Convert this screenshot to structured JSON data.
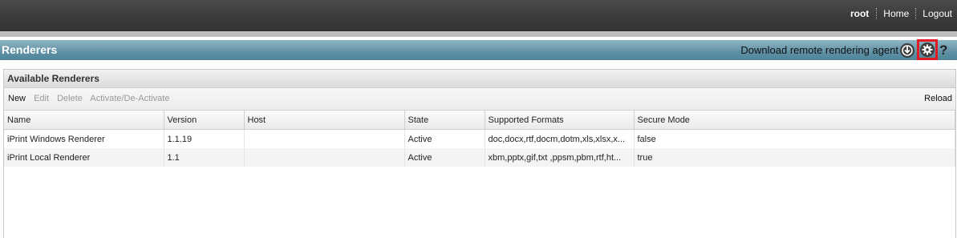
{
  "topnav": {
    "user": "root",
    "home": "Home",
    "logout": "Logout"
  },
  "header": {
    "title": "Renderers",
    "download_text": "Download remote rendering agent"
  },
  "panel": {
    "title": "Available Renderers",
    "toolbar": {
      "new": "New",
      "edit": "Edit",
      "delete": "Delete",
      "activate": "Activate/De-Activate",
      "reload": "Reload"
    },
    "columns": [
      "Name",
      "Version",
      "Host",
      "State",
      "Supported Formats",
      "Secure Mode"
    ],
    "rows": [
      {
        "name": "iPrint Windows Renderer",
        "version": "1.1.19",
        "host": "",
        "state": "Active",
        "formats": "doc,docx,rtf,docm,dotm,xls,xlsx,x...",
        "secure": "false"
      },
      {
        "name": "iPrint Local Renderer",
        "version": "1.1",
        "host": "",
        "state": "Active",
        "formats": "xbm,pptx,gif,txt ,ppsm,pbm,rtf,ht...",
        "secure": "true"
      }
    ]
  },
  "icons": {
    "download": "download-agent-icon",
    "settings": "gear-icon",
    "help": "help-icon"
  },
  "colors": {
    "topbar": "#3b3b3b",
    "header": "#5f91a5",
    "highlight": "#e31b23"
  }
}
